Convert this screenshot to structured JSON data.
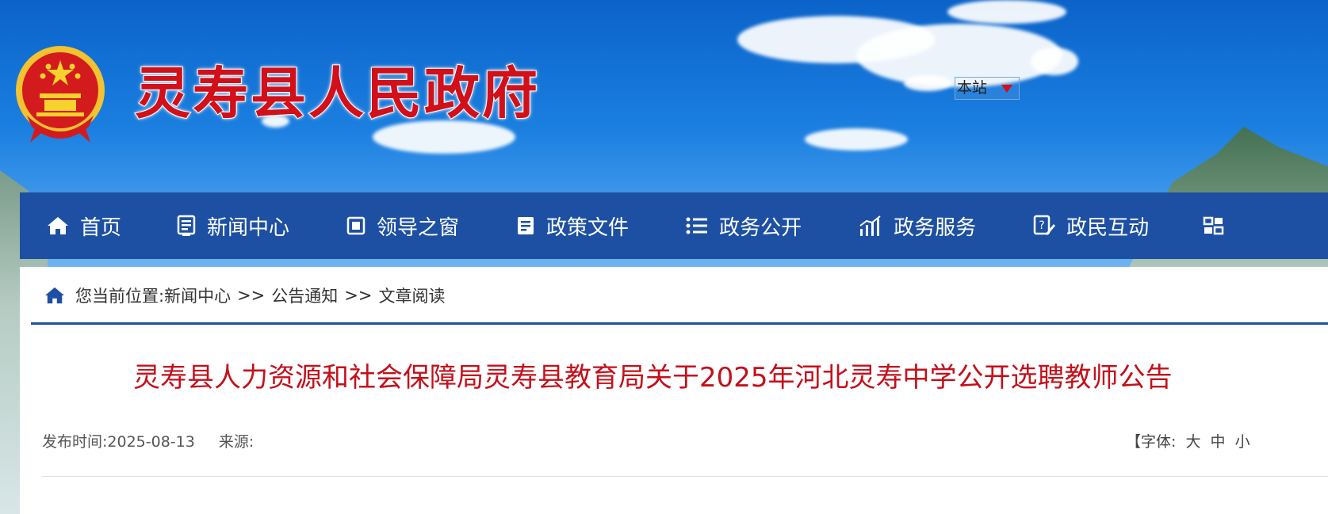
{
  "header": {
    "site_title": "灵寿县人民政府",
    "search_scope": "本站"
  },
  "nav": {
    "items": [
      {
        "label": "首页",
        "icon": "home-icon"
      },
      {
        "label": "新闻中心",
        "icon": "news-icon"
      },
      {
        "label": "领导之窗",
        "icon": "leader-icon"
      },
      {
        "label": "政策文件",
        "icon": "policy-icon"
      },
      {
        "label": "政务公开",
        "icon": "list-icon"
      },
      {
        "label": "政务服务",
        "icon": "chart-icon"
      },
      {
        "label": "政民互动",
        "icon": "interact-icon"
      },
      {
        "label": "",
        "icon": "special-icon"
      }
    ]
  },
  "breadcrumb": {
    "prefix": "您当前位置:",
    "items": [
      "新闻中心",
      "公告通知",
      "文章阅读"
    ],
    "separator": ">>"
  },
  "article": {
    "title": "灵寿县人力资源和社会保障局灵寿县教育局关于2025年河北灵寿中学公开选聘教师公告",
    "publish_label": "发布时间:",
    "publish_date": "2025-08-13",
    "source_label": "来源:",
    "source_value": "",
    "font_label": "【字体:",
    "font_large": "大",
    "font_medium": "中",
    "font_small": "小"
  },
  "colors": {
    "nav_bg": "#1d50a3",
    "title_red": "#c4101b",
    "site_title_red": "#d1101a"
  }
}
